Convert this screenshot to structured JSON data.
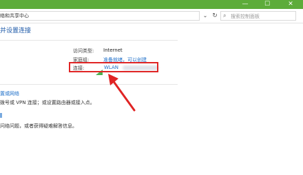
{
  "window": {
    "minimize": "—",
    "maximize": "☐",
    "close": "✕"
  },
  "address_bar": {
    "path": "络和共享中心",
    "dropdown_glyph": "⌄",
    "refresh_glyph": "↻"
  },
  "search": {
    "placeholder": "搜索控制面板",
    "icon": "search-icon"
  },
  "main": {
    "title": "并设置连接",
    "network_info": {
      "access_type_label": "访问类型:",
      "access_type_value": "Internet",
      "homegroup_label": "家庭组:",
      "homegroup_value": "准备就绪，可以创建",
      "connection_label": "连接:",
      "connection_value": "WLAN"
    },
    "settings": [
      {
        "link": "置或网络",
        "desc": "拨号或 VPN 连接；或设置路由器或接入点。"
      },
      {
        "link": "",
        "desc": "问络问题，或者获得疑难解答信息。"
      }
    ]
  },
  "colors": {
    "titlebar": "#5dac3a",
    "link": "#1e6fc9",
    "highlight": "#e02424"
  }
}
